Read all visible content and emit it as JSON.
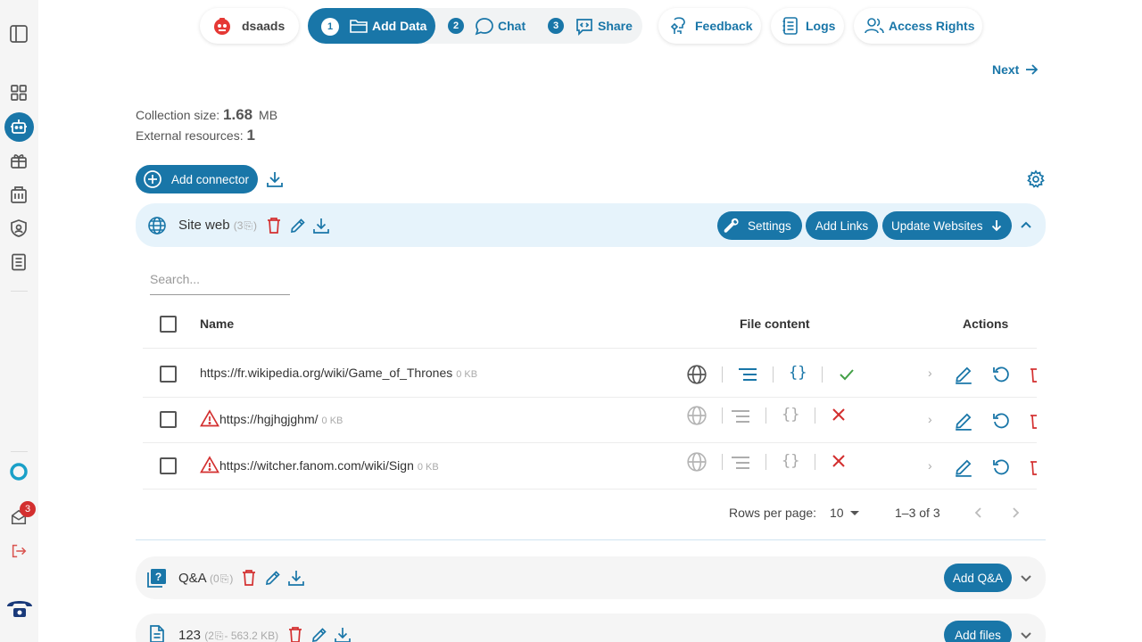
{
  "brand": {
    "project_name": "dsaads"
  },
  "steps": [
    {
      "num": "1",
      "label": "Add Data"
    },
    {
      "num": "2",
      "label": "Chat"
    },
    {
      "num": "3",
      "label": "Share"
    }
  ],
  "top_actions": {
    "feedback": "Feedback",
    "logs": "Logs",
    "access_rights": "Access Rights"
  },
  "next_label": "Next",
  "stats": {
    "collection_size_label": "Collection size:",
    "collection_size_value": "1.68",
    "collection_size_unit": "MB",
    "external_resources_label": "External resources:",
    "external_resources_value": "1"
  },
  "add_connector_label": "Add connector",
  "site_web": {
    "title": "Site web",
    "count": "(3",
    "count_end": ")",
    "settings_label": "Settings",
    "add_links_label": "Add Links",
    "update_websites_label": "Update Websites",
    "search_placeholder": "Search...",
    "columns": {
      "name": "Name",
      "file_content": "File content",
      "actions": "Actions"
    },
    "rows": [
      {
        "url": "https://fr.wikipedia.org/wiki/Game_of_Thrones",
        "size": "0 KB",
        "warning": false,
        "status": "ok"
      },
      {
        "url": "https://hgjhgjghm/",
        "size": "0 KB",
        "warning": true,
        "status": "error"
      },
      {
        "url": "https://witcher.fanom.com/wiki/Sign",
        "size": "0 KB",
        "warning": true,
        "status": "error"
      }
    ],
    "rows_per_page_label": "Rows per page:",
    "rows_per_page_value": "10",
    "page_range": "1–3 of 3"
  },
  "qa": {
    "title": "Q&A",
    "count": "(0",
    "count_end": ")",
    "add_label": "Add Q&A"
  },
  "files": {
    "title": "123",
    "count": "(2",
    "count_size": "- 563.2 KB)",
    "add_label": "Add files"
  },
  "notifications_count": "3",
  "colors": {
    "primary": "#1976a8",
    "danger": "#d32f2f",
    "success": "#43a047",
    "header_bg": "#e6f3fb"
  }
}
